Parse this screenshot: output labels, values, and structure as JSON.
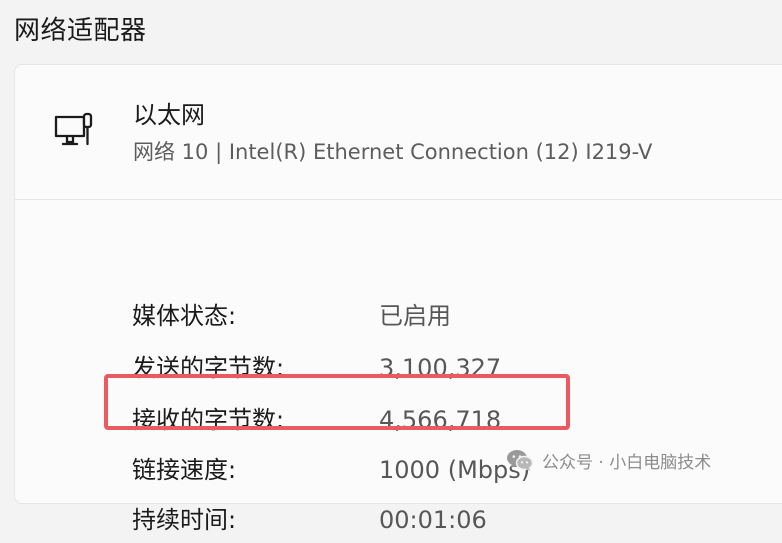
{
  "section": {
    "title": "网络适配器"
  },
  "adapter": {
    "icon": "ethernet-icon",
    "name": "以太网",
    "description": "网络 10 | Intel(R) Ethernet Connection (12) I219-V"
  },
  "properties": [
    {
      "label": "媒体状态:",
      "value": "已启用"
    },
    {
      "label": "发送的字节数:",
      "value": "3,100,327"
    },
    {
      "label": "接收的字节数:",
      "value": "4,566,718"
    },
    {
      "label": "链接速度:",
      "value": "1000 (Mbps)"
    },
    {
      "label": "持续时间:",
      "value": "00:01:06"
    }
  ],
  "highlight": {
    "color": "#ea5a60",
    "target": "链接速度"
  },
  "watermark": {
    "icon": "wechat-icon",
    "text": "公众号 · 小白电脑技术"
  }
}
